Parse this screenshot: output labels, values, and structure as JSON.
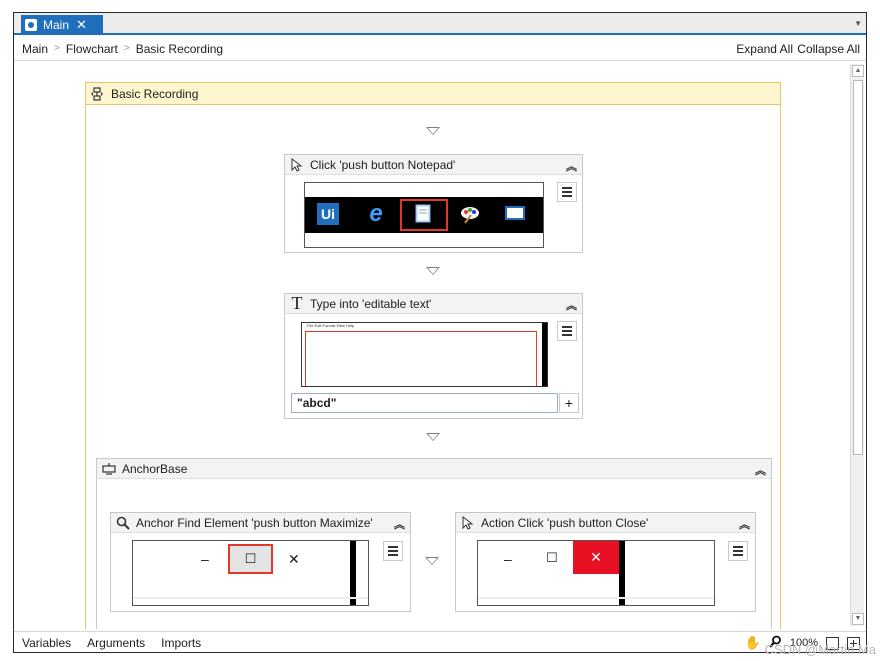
{
  "tab": {
    "label": "Main",
    "close": "✕"
  },
  "breadcrumb": {
    "items": [
      "Main",
      "Flowchart",
      "Basic Recording"
    ],
    "separator": ">"
  },
  "toolbar": {
    "expand_all": "Expand All",
    "collapse_all": "Collapse All"
  },
  "sequence": {
    "title": "Basic Recording"
  },
  "activities": {
    "click_notepad": {
      "title": "Click 'push button  Notepad'"
    },
    "type_into": {
      "title": "Type into 'editable text'",
      "text_value": "\"abcd\"",
      "menu_text": "File  Edit  Format  View  Help"
    },
    "anchor_base": {
      "title": "AnchorBase"
    },
    "anchor_find": {
      "title": "Anchor Find Element 'push button  Maximize'"
    },
    "action_click": {
      "title": "Action Click 'push button  Close'"
    }
  },
  "window_controls": {
    "minimize": "–",
    "maximize": "☐",
    "close": "✕"
  },
  "taskbar_icon_ui": "Ui",
  "statusbar": {
    "variables": "Variables",
    "arguments": "Arguments",
    "imports": "Imports",
    "zoom": "100%"
  },
  "watermark": "CSDN @Martin Ma",
  "colors": {
    "accent": "#1f6fbd",
    "sequence_border": "#e7c36a",
    "sequence_header": "#fff6cf",
    "highlight": "#e0392b"
  }
}
